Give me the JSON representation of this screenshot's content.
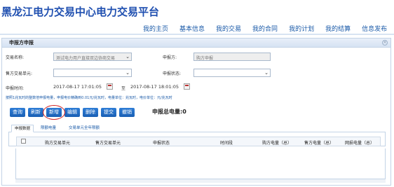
{
  "header": {
    "brand": "黑龙江电力交易中心电力交易平台",
    "nav": [
      "我的主页",
      "基本信息",
      "我的交易",
      "我的合同",
      "我的计划",
      "我的结算",
      "信息发布"
    ]
  },
  "panel": {
    "title": "申报方申报",
    "close_glyph": "×"
  },
  "form": {
    "trade_name_label": "交易名称:",
    "trade_name_value": "测试电力用户直接双边协商交易",
    "declarer_label": "申报方:",
    "declarer_value": "购方申报",
    "seller_unit_label": "售方交易单元:",
    "seller_unit_value": "",
    "status_label": "申报状态:",
    "status_value": "",
    "time_label": "申报时间:",
    "time_start": "2017-08-17 17:01:05",
    "time_to": "至",
    "time_end": "2017-08-17 18:01:05"
  },
  "note": "按照1兆瓦时的整数倍申报电量，申报电价精确到0.01元/兆瓦时，电量单位：兆瓦时，电价单位：元/兆瓦时",
  "buttons": [
    "查询",
    "刷新",
    "新增",
    "编辑",
    "删除",
    "提交",
    "撤销"
  ],
  "summary": "申报总电量:0",
  "tabs": [
    "申报数据",
    "限额电量",
    "交易单元全年限额"
  ],
  "table": {
    "columns": [
      "购方交易单元",
      "售方交易单元",
      "申报状态",
      "时间段",
      "购方电量（总）",
      "售方电量（总）",
      "网损电量（总）"
    ]
  },
  "colors": {
    "primary": "#1a5fb4",
    "brand": "#1f4fb0",
    "highlight": "#d02020"
  }
}
